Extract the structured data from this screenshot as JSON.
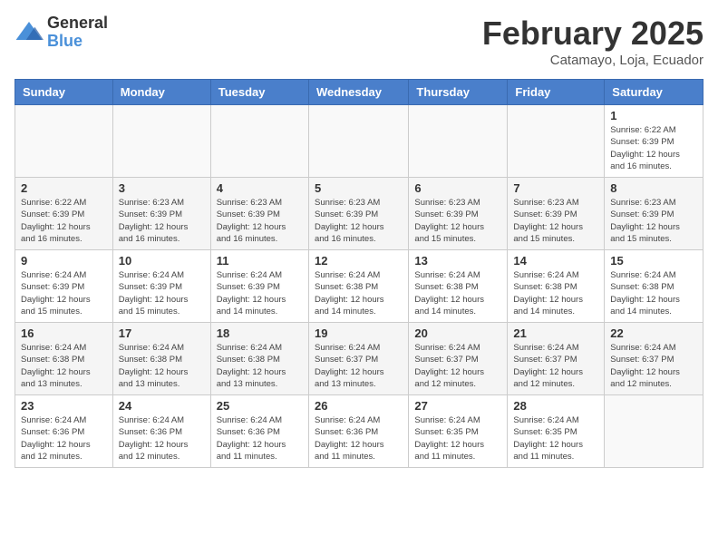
{
  "logo": {
    "general": "General",
    "blue": "Blue"
  },
  "title": "February 2025",
  "subtitle": "Catamayo, Loja, Ecuador",
  "weekdays": [
    "Sunday",
    "Monday",
    "Tuesday",
    "Wednesday",
    "Thursday",
    "Friday",
    "Saturday"
  ],
  "weeks": [
    [
      {
        "day": "",
        "info": ""
      },
      {
        "day": "",
        "info": ""
      },
      {
        "day": "",
        "info": ""
      },
      {
        "day": "",
        "info": ""
      },
      {
        "day": "",
        "info": ""
      },
      {
        "day": "",
        "info": ""
      },
      {
        "day": "1",
        "info": "Sunrise: 6:22 AM\nSunset: 6:39 PM\nDaylight: 12 hours\nand 16 minutes."
      }
    ],
    [
      {
        "day": "2",
        "info": "Sunrise: 6:22 AM\nSunset: 6:39 PM\nDaylight: 12 hours\nand 16 minutes."
      },
      {
        "day": "3",
        "info": "Sunrise: 6:23 AM\nSunset: 6:39 PM\nDaylight: 12 hours\nand 16 minutes."
      },
      {
        "day": "4",
        "info": "Sunrise: 6:23 AM\nSunset: 6:39 PM\nDaylight: 12 hours\nand 16 minutes."
      },
      {
        "day": "5",
        "info": "Sunrise: 6:23 AM\nSunset: 6:39 PM\nDaylight: 12 hours\nand 16 minutes."
      },
      {
        "day": "6",
        "info": "Sunrise: 6:23 AM\nSunset: 6:39 PM\nDaylight: 12 hours\nand 15 minutes."
      },
      {
        "day": "7",
        "info": "Sunrise: 6:23 AM\nSunset: 6:39 PM\nDaylight: 12 hours\nand 15 minutes."
      },
      {
        "day": "8",
        "info": "Sunrise: 6:23 AM\nSunset: 6:39 PM\nDaylight: 12 hours\nand 15 minutes."
      }
    ],
    [
      {
        "day": "9",
        "info": "Sunrise: 6:24 AM\nSunset: 6:39 PM\nDaylight: 12 hours\nand 15 minutes."
      },
      {
        "day": "10",
        "info": "Sunrise: 6:24 AM\nSunset: 6:39 PM\nDaylight: 12 hours\nand 15 minutes."
      },
      {
        "day": "11",
        "info": "Sunrise: 6:24 AM\nSunset: 6:39 PM\nDaylight: 12 hours\nand 14 minutes."
      },
      {
        "day": "12",
        "info": "Sunrise: 6:24 AM\nSunset: 6:38 PM\nDaylight: 12 hours\nand 14 minutes."
      },
      {
        "day": "13",
        "info": "Sunrise: 6:24 AM\nSunset: 6:38 PM\nDaylight: 12 hours\nand 14 minutes."
      },
      {
        "day": "14",
        "info": "Sunrise: 6:24 AM\nSunset: 6:38 PM\nDaylight: 12 hours\nand 14 minutes."
      },
      {
        "day": "15",
        "info": "Sunrise: 6:24 AM\nSunset: 6:38 PM\nDaylight: 12 hours\nand 14 minutes."
      }
    ],
    [
      {
        "day": "16",
        "info": "Sunrise: 6:24 AM\nSunset: 6:38 PM\nDaylight: 12 hours\nand 13 minutes."
      },
      {
        "day": "17",
        "info": "Sunrise: 6:24 AM\nSunset: 6:38 PM\nDaylight: 12 hours\nand 13 minutes."
      },
      {
        "day": "18",
        "info": "Sunrise: 6:24 AM\nSunset: 6:38 PM\nDaylight: 12 hours\nand 13 minutes."
      },
      {
        "day": "19",
        "info": "Sunrise: 6:24 AM\nSunset: 6:37 PM\nDaylight: 12 hours\nand 13 minutes."
      },
      {
        "day": "20",
        "info": "Sunrise: 6:24 AM\nSunset: 6:37 PM\nDaylight: 12 hours\nand 12 minutes."
      },
      {
        "day": "21",
        "info": "Sunrise: 6:24 AM\nSunset: 6:37 PM\nDaylight: 12 hours\nand 12 minutes."
      },
      {
        "day": "22",
        "info": "Sunrise: 6:24 AM\nSunset: 6:37 PM\nDaylight: 12 hours\nand 12 minutes."
      }
    ],
    [
      {
        "day": "23",
        "info": "Sunrise: 6:24 AM\nSunset: 6:36 PM\nDaylight: 12 hours\nand 12 minutes."
      },
      {
        "day": "24",
        "info": "Sunrise: 6:24 AM\nSunset: 6:36 PM\nDaylight: 12 hours\nand 12 minutes."
      },
      {
        "day": "25",
        "info": "Sunrise: 6:24 AM\nSunset: 6:36 PM\nDaylight: 12 hours\nand 11 minutes."
      },
      {
        "day": "26",
        "info": "Sunrise: 6:24 AM\nSunset: 6:36 PM\nDaylight: 12 hours\nand 11 minutes."
      },
      {
        "day": "27",
        "info": "Sunrise: 6:24 AM\nSunset: 6:35 PM\nDaylight: 12 hours\nand 11 minutes."
      },
      {
        "day": "28",
        "info": "Sunrise: 6:24 AM\nSunset: 6:35 PM\nDaylight: 12 hours\nand 11 minutes."
      },
      {
        "day": "",
        "info": ""
      }
    ]
  ]
}
